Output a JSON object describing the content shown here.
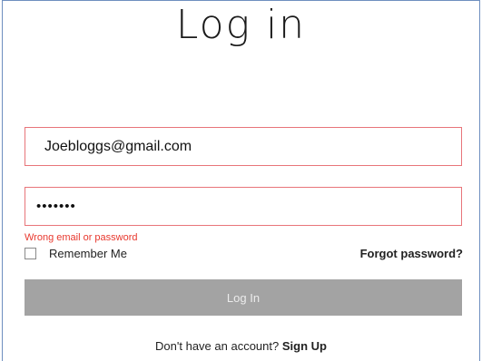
{
  "page": {
    "title": "Log in"
  },
  "form": {
    "email_value": "Joebloggs@gmail.com",
    "password_value": "•••••••",
    "error_text": "Wrong email or password",
    "remember_label": "Remember Me",
    "remember_checked": false,
    "forgot_label": "Forgot password?",
    "submit_label": "Log In"
  },
  "footer": {
    "prompt": "Don't have an account?",
    "signup_label": "Sign Up"
  },
  "colors": {
    "field_border_error": "#e8757a",
    "error_text": "#e8382e",
    "button_bg": "#a3a3a3",
    "frame_border": "#6f8fbf"
  }
}
